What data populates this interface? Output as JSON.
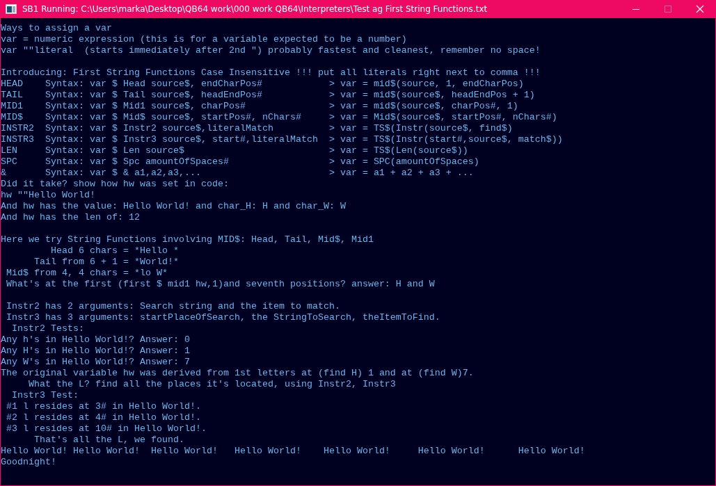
{
  "window": {
    "title": "SB1 Running: C:\\Users\\marka\\Desktop\\QB64 work\\000 work QB64\\Interpreters\\Test ag First String Functions.txt",
    "controls": [
      {
        "kind": "minimize",
        "disabled": false
      },
      {
        "kind": "maximize",
        "disabled": true
      },
      {
        "kind": "close",
        "disabled": false
      }
    ]
  },
  "console": {
    "lines": [
      {
        "kind": "text",
        "text": "Ways to assign a var"
      },
      {
        "kind": "text",
        "text": "var = numeric expression (this is for a variable expected to be a number)"
      },
      {
        "kind": "text",
        "text": "var \"\"literal  (starts immediately after 2nd \") probably fastest and cleanest, remember no space!"
      },
      {
        "kind": "blank"
      },
      {
        "kind": "text",
        "text": "Introducing: First String Functions Case Insensitive !!! put all literals right next to comma !!!"
      },
      {
        "kind": "syntax",
        "keyword": "HEAD",
        "syntax": "Syntax: var $ Head source$, endCharPos#",
        "result": "> var = mid$(source, 1, endCharPos)"
      },
      {
        "kind": "syntax",
        "keyword": "TAIL",
        "syntax": "Syntax: var $ Tail source$, headEndPos#",
        "result": "> var = mid$(source$, headEndPos + 1)"
      },
      {
        "kind": "syntax",
        "keyword": "MID1",
        "syntax": "Syntax: var $ Mid1 source$, charPos#",
        "result": "> var = mid$(source$, charPos#, 1)"
      },
      {
        "kind": "syntax",
        "keyword": "MID$",
        "syntax": "Syntax: var $ Mid$ source$, startPos#, nChars#",
        "result": "> var = Mid$(source$, startPos#, nChars#)"
      },
      {
        "kind": "syntax",
        "keyword": "INSTR2",
        "syntax": "Syntax: var $ Instr2 source$,literalMatch",
        "result": "> var = TS$(Instr(source$, find$)"
      },
      {
        "kind": "syntax",
        "keyword": "INSTR3",
        "syntax": "Syntax: var $ Instr3 source$, start#,literalMatch",
        "result": "> var = TS$(Instr(start#,source$, match$))"
      },
      {
        "kind": "syntax",
        "keyword": "LEN",
        "syntax": "Syntax: var $ Len source$",
        "result": "> var = TS$(Len(source$))"
      },
      {
        "kind": "syntax",
        "keyword": "SPC",
        "syntax": "Syntax: var $ Spc amountOfSpaces#",
        "result": "> var = SPC(amountOfSpaces)"
      },
      {
        "kind": "syntax",
        "keyword": "&",
        "syntax": "Syntax: var $ & a1,a2,a3,...",
        "result": "> var = a1 + a2 + a3 + ..."
      },
      {
        "kind": "text",
        "text": "Did it take? show how hw was set in code:"
      },
      {
        "kind": "text",
        "text": "hw \"\"Hello World!"
      },
      {
        "kind": "text",
        "text": "And hw has the value: Hello World! and char_H: H and char_W: W"
      },
      {
        "kind": "text",
        "text": "And hw has the len of: 12"
      },
      {
        "kind": "blank"
      },
      {
        "kind": "text",
        "text": "Here we try String Functions involving MID$: Head, Tail, Mid$, Mid1"
      },
      {
        "kind": "text",
        "text": "         Head 6 chars = *Hello *"
      },
      {
        "kind": "text",
        "text": "      Tail from 6 + 1 = *World!*"
      },
      {
        "kind": "text",
        "text": " Mid$ from 4, 4 chars = *lo W*"
      },
      {
        "kind": "text",
        "text": " What's at the first (first $ mid1 hw,1)and seventh positions? answer: H and W"
      },
      {
        "kind": "blank"
      },
      {
        "kind": "text",
        "text": " Instr2 has 2 arguments: Search string and the item to match."
      },
      {
        "kind": "text",
        "text": " Instr3 has 3 arguments: startPlaceOfSearch, the StringToSearch, theItemToFind."
      },
      {
        "kind": "text",
        "text": "  Instr2 Tests:"
      },
      {
        "kind": "text",
        "text": "Any h's in Hello World!? Answer: 0"
      },
      {
        "kind": "text",
        "text": "Any H's in Hello World!? Answer: 1"
      },
      {
        "kind": "text",
        "text": "Any W's in Hello World!? Answer: 7"
      },
      {
        "kind": "text",
        "text": "The original variable hw was derived from 1st letters at (find H) 1 and at (find W)7."
      },
      {
        "kind": "text",
        "text": "     What the L? find all the places it's located, using Instr2, Instr3"
      },
      {
        "kind": "text",
        "text": "  Instr3 Test:"
      },
      {
        "kind": "text",
        "text": " #1 l resides at 3# in Hello World!."
      },
      {
        "kind": "text",
        "text": " #2 l resides at 4# in Hello World!."
      },
      {
        "kind": "text",
        "text": " #3 l resides at 10# in Hello World!."
      },
      {
        "kind": "text",
        "text": "      That's all the L, we found."
      },
      {
        "kind": "text",
        "text": "Hello World! Hello World!  Hello World!   Hello World!    Hello World!     Hello World!      Hello World!"
      },
      {
        "kind": "text",
        "text": "Goodnight!"
      }
    ]
  }
}
